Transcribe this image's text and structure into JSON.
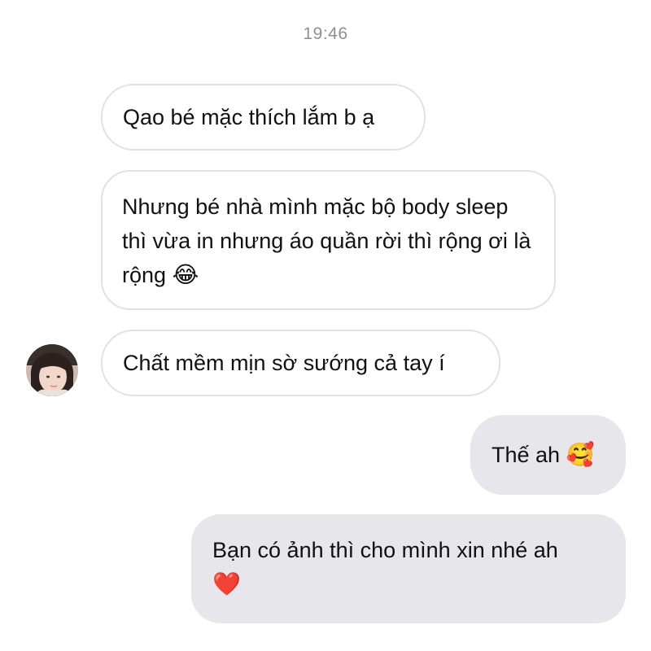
{
  "chat": {
    "timestamp": "19:46",
    "messages": [
      {
        "direction": "received",
        "text": "Qao bé mặc thích lắm b ạ",
        "emoji": ""
      },
      {
        "direction": "received",
        "text": "Nhưng bé nhà mình mặc bộ body sleep thì vừa in nhưng áo quần rời thì rộng ơi là rộng",
        "emoji": "😂"
      },
      {
        "direction": "received",
        "text": "Chất mềm mịn sờ sướng cả tay í",
        "emoji": ""
      },
      {
        "direction": "sent",
        "text": "Thế ah",
        "emoji": "🥰"
      },
      {
        "direction": "sent",
        "text": "Bạn có ảnh thì cho mình xin nhé ah",
        "emoji": "❤️"
      }
    ]
  },
  "colors": {
    "sent_bubble": "#e6e6eb",
    "received_border": "#e2e2e4",
    "timestamp": "#8e8e93"
  },
  "icons": {
    "avatar": "contact-avatar"
  }
}
